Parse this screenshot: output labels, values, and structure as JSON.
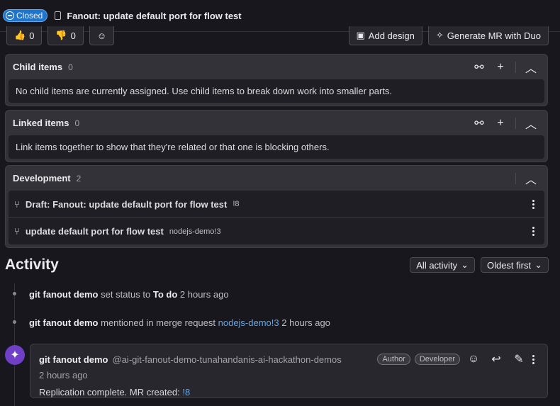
{
  "header": {
    "status": "Closed",
    "title": "Fanout: update default port for flow test"
  },
  "reactions": {
    "thumbsup_count": "0",
    "thumbsdown_count": "0"
  },
  "actions": {
    "add_design": "Add design",
    "generate_mr": "Generate MR with Duo"
  },
  "child_items": {
    "title": "Child items",
    "count": "0",
    "empty_text": "No child items are currently assigned. Use child items to break down work into smaller parts."
  },
  "linked_items": {
    "title": "Linked items",
    "count": "0",
    "empty_text": "Link items together to show that they're related or that one is blocking others."
  },
  "development": {
    "title": "Development",
    "count": "2",
    "items": [
      {
        "name": "Draft: Fanout: update default port for flow test",
        "ref": "!8"
      },
      {
        "name": "update default port for flow test",
        "ref": "nodejs-demo!3"
      }
    ]
  },
  "activity": {
    "title": "Activity",
    "filter": "All activity",
    "sort": "Oldest first",
    "events": [
      {
        "author": "git fanout demo",
        "text": "set status to",
        "value": "To do",
        "time": "2 hours ago"
      },
      {
        "author": "git fanout demo",
        "text": "mentioned in merge request",
        "link": "nodejs-demo!3",
        "time": "2 hours ago"
      }
    ],
    "note": {
      "author": "git fanout demo",
      "handle": "@ai-git-fanout-demo-tunahandanis-ai-hackathon-demos",
      "badges": [
        "Author",
        "Developer"
      ],
      "time": "2 hours ago",
      "body": "Replication complete. MR created:",
      "link": "!8"
    }
  },
  "colors": {
    "background": "#18171d",
    "card": "#333238",
    "closed_badge": "#1f75cb",
    "link": "#63a6e9",
    "avatar": "#6f3fc7"
  }
}
